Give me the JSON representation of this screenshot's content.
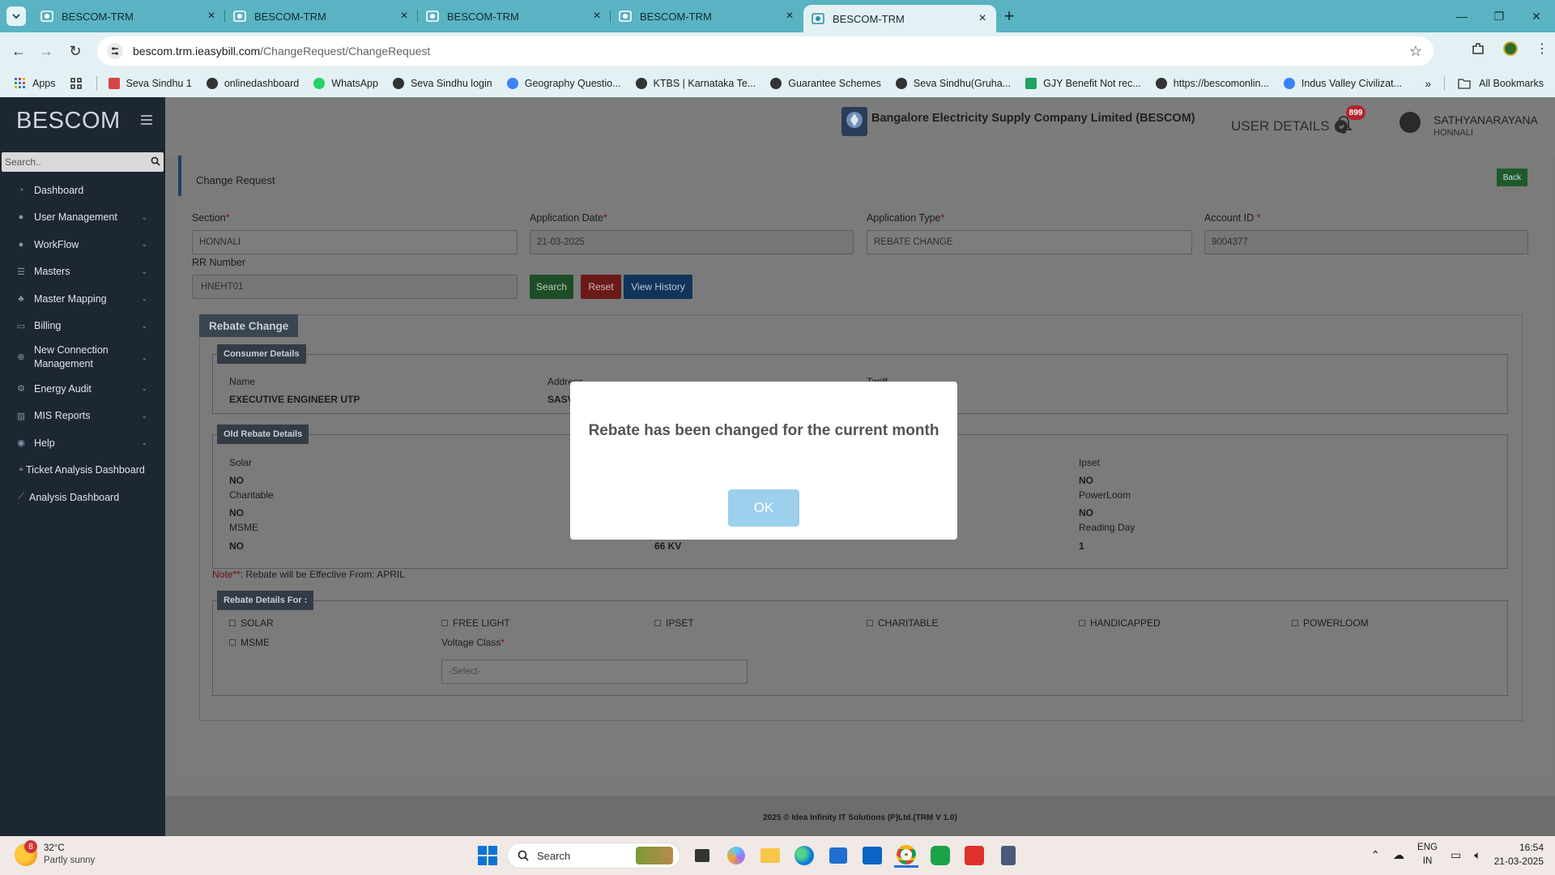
{
  "browser": {
    "tabs": [
      {
        "title": "BESCOM-TRM"
      },
      {
        "title": "BESCOM-TRM"
      },
      {
        "title": "BESCOM-TRM"
      },
      {
        "title": "BESCOM-TRM"
      },
      {
        "title": "BESCOM-TRM"
      }
    ],
    "url_host": "bescom.trm.ieasybill.com",
    "url_path": "/ChangeRequest/ChangeRequest",
    "bookmarks": [
      {
        "label": "Apps",
        "icon": "apps-grid-icon"
      },
      {
        "label": "Seva Sindhu 1",
        "icon": "seva-sindhu-icon",
        "color": "#d64545"
      },
      {
        "label": "onlinedashboard",
        "icon": "globe-icon",
        "color": "#333333"
      },
      {
        "label": "WhatsApp",
        "icon": "whatsapp-icon",
        "color": "#25d366"
      },
      {
        "label": "Seva Sindhu login",
        "icon": "globe-icon",
        "color": "#333333"
      },
      {
        "label": "Geography Questio...",
        "icon": "c-icon",
        "color": "#3b82f6"
      },
      {
        "label": "KTBS | Karnataka Te...",
        "icon": "globe-icon",
        "color": "#333333"
      },
      {
        "label": "Guarantee Schemes",
        "icon": "globe-icon",
        "color": "#333333"
      },
      {
        "label": "Seva Sindhu(Gruha...",
        "icon": "globe-icon",
        "color": "#333333"
      },
      {
        "label": "GJY Benefit Not rec...",
        "icon": "sheets-icon",
        "color": "#1ea362"
      },
      {
        "label": "https://bescomonlin...",
        "icon": "globe-icon",
        "color": "#333333"
      },
      {
        "label": "Indus Valley Civilizat...",
        "icon": "c-icon",
        "color": "#3b82f6"
      }
    ],
    "all_bookmarks": "All Bookmarks"
  },
  "sidebar": {
    "brand": "BESCOM",
    "search_placeholder": "Search..",
    "items": [
      {
        "label": "Dashboard",
        "icon": "dashboard-icon",
        "expand": false
      },
      {
        "label": "User Management",
        "icon": "user-icon",
        "expand": true
      },
      {
        "label": "WorkFlow",
        "icon": "user-icon",
        "expand": true
      },
      {
        "label": "Masters",
        "icon": "list-icon",
        "expand": true
      },
      {
        "label": "Master Mapping",
        "icon": "sitemap-icon",
        "expand": true
      },
      {
        "label": "Billing",
        "icon": "monitor-icon",
        "expand": true
      },
      {
        "label": "New Connection Management",
        "icon": "plus-circle-icon",
        "expand": true
      },
      {
        "label": "Energy Audit",
        "icon": "cogs-icon",
        "expand": true
      },
      {
        "label": "MIS Reports",
        "icon": "bar-chart-icon",
        "expand": true
      },
      {
        "label": "Help",
        "icon": "help-icon",
        "expand": true
      },
      {
        "label": "Ticket Analysis Dashboard",
        "icon": "pin-icon",
        "expand": false
      },
      {
        "label": "Analysis Dashboard",
        "icon": "line-chart-icon",
        "expand": false
      }
    ]
  },
  "header": {
    "org_name": "Bangalore Electricity Supply Company Limited (BESCOM)",
    "user_details": "USER DETAILS",
    "notification_count": "899",
    "username": "SATHYANARAYANA",
    "user_location": "HONNALI"
  },
  "page": {
    "title": "Change Request",
    "back": "Back",
    "section_label": "Section",
    "section_value": "HONNALI",
    "app_date_label": "Application Date",
    "app_date_value": "21-03-2025",
    "app_type_label": "Application Type",
    "app_type_value": "REBATE CHANGE",
    "account_label": "Account ID",
    "account_value": "9004377",
    "rr_label": "RR Number",
    "rr_value": "HNEHT01",
    "search_btn": "Search",
    "reset_btn": "Reset",
    "history_btn": "View History"
  },
  "rebate": {
    "tab": "Rebate Change",
    "consumer_legend": "Consumer Details",
    "name_label": "Name",
    "name_value": "EXECUTIVE ENGINEER UTP",
    "address_label": "Address",
    "address_value": "SASV",
    "tariff_label": "Tariff",
    "old_legend": "Old Rebate Details",
    "old_left": [
      {
        "label": "Solar",
        "value": "NO"
      },
      {
        "label": "Charitable",
        "value": "NO"
      },
      {
        "label": "MSME",
        "value": "NO"
      }
    ],
    "old_mid_value": "66 KV",
    "old_right": [
      {
        "label": "Ipset",
        "value": "NO"
      },
      {
        "label": "PowerLoom",
        "value": "NO"
      },
      {
        "label": "Reading Day",
        "value": "1"
      }
    ],
    "note_prefix": "Note**",
    "note_text": ": Rebate will be Effective From: ",
    "note_month": "APRIL",
    "details_legend": "Rebate Details For :",
    "checkboxes": [
      "SOLAR",
      "FREE LIGHT",
      "IPSET",
      "CHARITABLE",
      "HANDICAPPED",
      "POWERLOOM",
      "MSME"
    ],
    "voltage_label": "Voltage Class",
    "voltage_value": "-Select-"
  },
  "footer": "2025 © Idea Infinity IT Solutions (P)Ltd.(TRM V 1.0)",
  "modal": {
    "message": "Rebate has been changed for the current month",
    "ok": "OK"
  },
  "taskbar": {
    "weather_badge": "8",
    "temp": "32°C",
    "condition": "Partly sunny",
    "search": "Search",
    "lang1": "ENG",
    "lang2": "IN",
    "time": "16:54",
    "date": "21-03-2025"
  }
}
